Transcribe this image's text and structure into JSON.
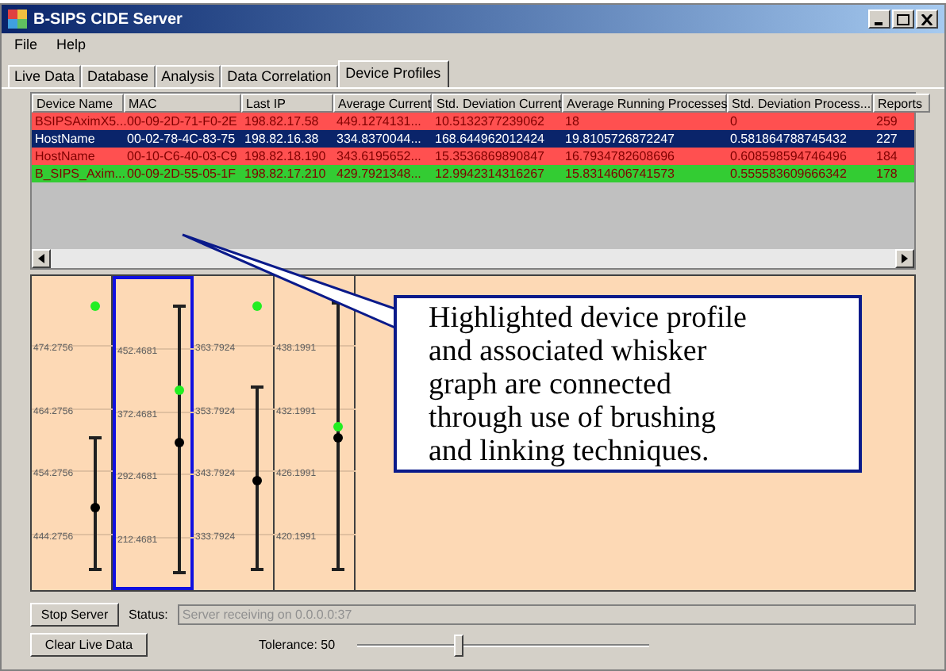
{
  "window": {
    "title": "B-SIPS CIDE Server"
  },
  "menu": [
    "File",
    "Help"
  ],
  "tabs": [
    {
      "label": "Live Data",
      "selected": false
    },
    {
      "label": "Database",
      "selected": false
    },
    {
      "label": "Analysis",
      "selected": false
    },
    {
      "label": "Data Correlation",
      "selected": false
    },
    {
      "label": "Device Profiles",
      "selected": true
    }
  ],
  "table": {
    "columns": [
      "Device Name",
      "MAC",
      "Last IP",
      "Average Current",
      "Std. Deviation Current",
      "Average Running Processes",
      "Std. Deviation Process...",
      "Reports"
    ],
    "rows": [
      {
        "color": "#ff5050",
        "selected": false,
        "cells": [
          "BSIPSAximX5...",
          "00-09-2D-71-F0-2E",
          "198.82.17.58",
          "449.1274131...",
          "10.5132377239062",
          "18",
          "0",
          "259"
        ]
      },
      {
        "selected": true,
        "cells": [
          "HostName",
          "00-02-78-4C-83-75",
          "198.82.16.38",
          "334.8370044...",
          "168.644962012424",
          "19.8105726872247",
          "0.581864788745432",
          "227"
        ]
      },
      {
        "color": "#ff5050",
        "selected": false,
        "cells": [
          "HostName",
          "00-10-C6-40-03-C9",
          "198.82.18.190",
          "343.6195652...",
          "15.3536869890847",
          "16.7934782608696",
          "0.608598594746496",
          "184"
        ]
      },
      {
        "color": "#33cc33",
        "selected": false,
        "cells": [
          "B_SIPS_Axim...",
          "00-09-2D-55-05-1F",
          "198.82.17.210",
          "429.7921348...",
          "12.9942314316267",
          "15.8314606741573",
          "0.555583609666342",
          "178"
        ]
      }
    ]
  },
  "graph": {
    "columns": [
      {
        "selected": false,
        "labels": [
          "474.2756",
          "464.2756",
          "454.2756",
          "444.2756"
        ]
      },
      {
        "selected": true,
        "labels": [
          "452.4681",
          "372.4681",
          "292.4681",
          "212.4681"
        ]
      },
      {
        "selected": false,
        "labels": [
          "363.7924",
          "353.7924",
          "343.7924",
          "333.7924"
        ]
      },
      {
        "selected": false,
        "labels": [
          "438.1991",
          "432.1991",
          "426.1991",
          "420.1991"
        ]
      }
    ]
  },
  "callout": "Highlighted device profile and associated whisker graph are connected through use of brushing and linking techniques.",
  "controls": {
    "stop_button": "Stop Server",
    "status_label": "Status:",
    "status_value": "Server receiving on 0.0.0.0:37",
    "clear_button": "Clear Live Data",
    "tolerance_label": "Tolerance: 50",
    "tolerance": {
      "level": 0.35
    }
  }
}
